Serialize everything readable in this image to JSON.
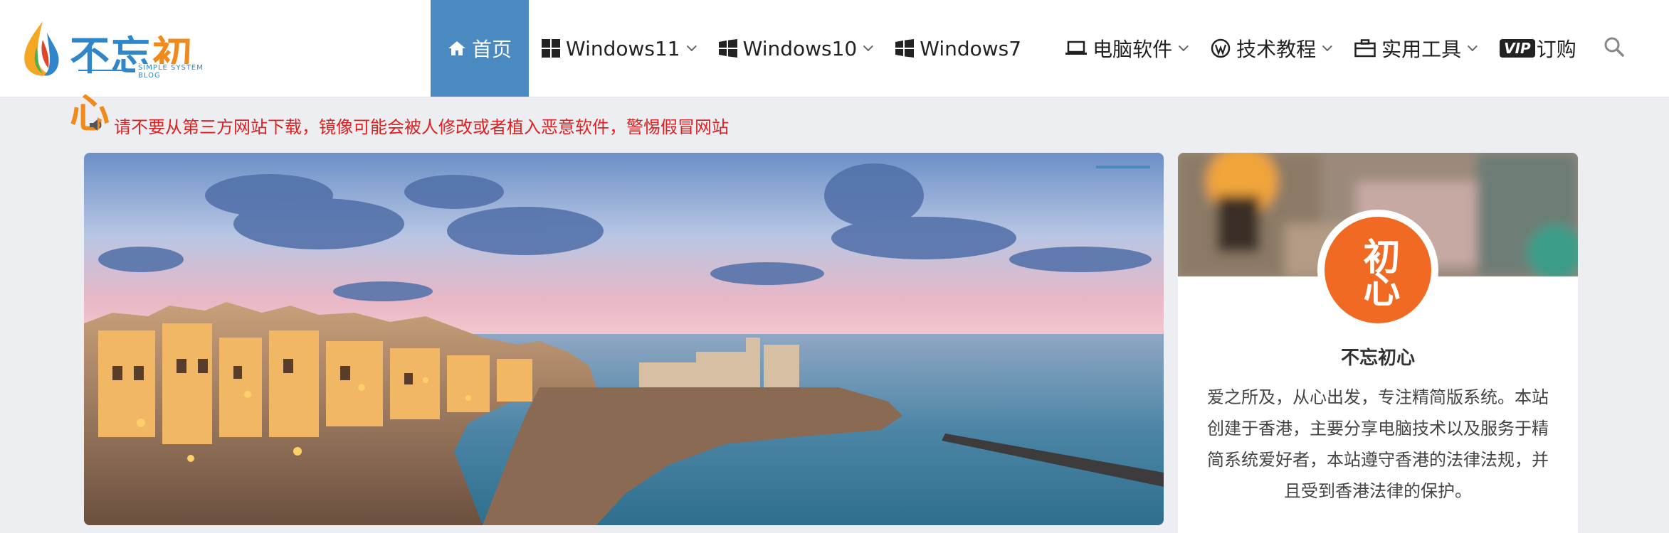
{
  "site": {
    "logo_main": "不忘",
    "logo_accent": "初心",
    "logo_sub": "SIMPLE SYSTEM BLOG"
  },
  "nav": {
    "items": [
      {
        "label": "首页",
        "icon": "home-icon",
        "active": true
      },
      {
        "label": "Windows11",
        "icon": "windows-icon",
        "dropdown": true
      },
      {
        "label": "Windows10",
        "icon": "windows-icon",
        "dropdown": true
      },
      {
        "label": "Windows7",
        "icon": "windows-icon",
        "dropdown": false
      },
      {
        "label": "电脑软件",
        "icon": "laptop-icon",
        "dropdown": true
      },
      {
        "label": "技术教程",
        "icon": "wordpress-icon",
        "dropdown": true
      },
      {
        "label": "实用工具",
        "icon": "briefcase-icon",
        "dropdown": true
      },
      {
        "label": "订购",
        "icon": "vip-icon",
        "dropdown": false
      }
    ],
    "vip_badge": "VIP"
  },
  "notice": {
    "text": "请不要从第三方网站下载，镜像可能会被人修改或者植入恶意软件，警惕假冒网站"
  },
  "profile": {
    "name": "不忘初心",
    "avatar_text": "初心",
    "description": "爱之所及，从心出发，专注精简版系统。本站创建于香港，主要分享电脑技术以及服务于精简系统爱好者，本站遵守香港的法律法规，并且受到香港法律的保护。"
  },
  "colors": {
    "accent": "#4a8ac0",
    "notice": "#e02020",
    "avatar_bg": "#f06a24"
  }
}
